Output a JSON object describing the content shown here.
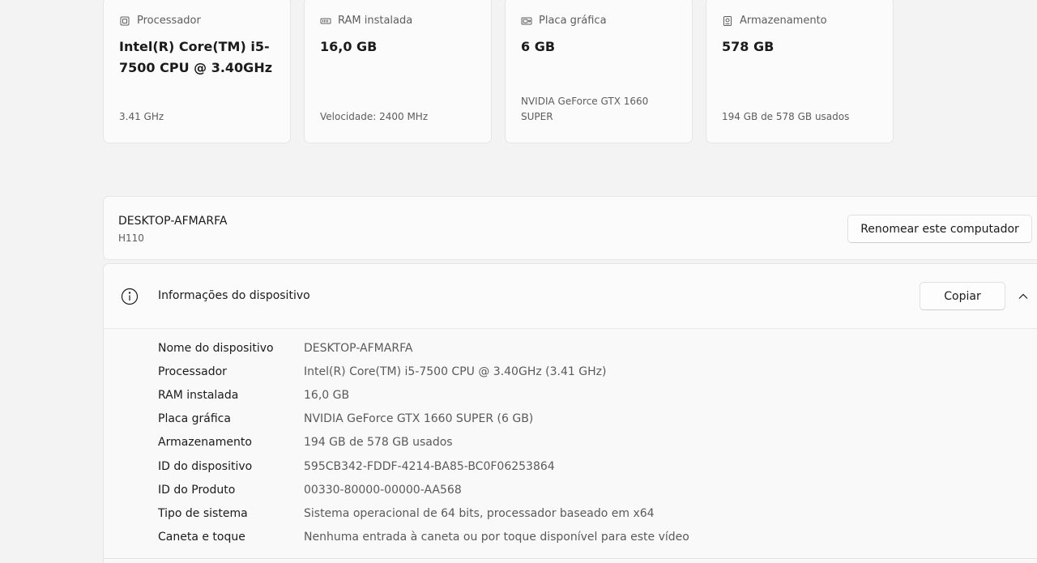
{
  "cards": [
    {
      "icon": "processor-icon",
      "label": "Processador",
      "value": "Intel(R) Core(TM) i5-7500 CPU @ 3.40GHz",
      "sub": "3.41 GHz"
    },
    {
      "icon": "ram-icon",
      "label": "RAM instalada",
      "value": "16,0 GB",
      "sub": "Velocidade: 2400 MHz"
    },
    {
      "icon": "graphics-card-icon",
      "label": "Placa gráfica",
      "value": "6 GB",
      "sub": "NVIDIA GeForce GTX 1660 SUPER"
    },
    {
      "icon": "storage-icon",
      "label": "Armazenamento",
      "value": "578 GB",
      "sub": "194 GB de 578 GB usados"
    }
  ],
  "device": {
    "name": "DESKTOP-AFMARFA",
    "model": "H110",
    "rename_label": "Renomear este computador"
  },
  "info": {
    "title": "Informações do dispositivo",
    "copy_label": "Copiar",
    "rows": [
      {
        "key": "Nome do dispositivo",
        "value": "DESKTOP-AFMARFA"
      },
      {
        "key": "Processador",
        "value": "Intel(R) Core(TM) i5-7500 CPU @ 3.40GHz (3.41 GHz)"
      },
      {
        "key": "RAM instalada",
        "value": "16,0 GB"
      },
      {
        "key": "Placa gráfica",
        "value": "NVIDIA GeForce GTX 1660 SUPER (6 GB)"
      },
      {
        "key": "Armazenamento",
        "value": "194 GB de 578 GB usados"
      },
      {
        "key": "ID do dispositivo",
        "value": "595CB342-FDDF-4214-BA85-BC0F06253864"
      },
      {
        "key": "ID do Produto",
        "value": "00330-80000-00000-AA568"
      },
      {
        "key": "Tipo de sistema",
        "value": "Sistema operacional de 64 bits, processador baseado em x64"
      },
      {
        "key": "Caneta e toque",
        "value": "Nenhuma entrada à caneta ou por toque disponível para este vídeo"
      }
    ]
  }
}
